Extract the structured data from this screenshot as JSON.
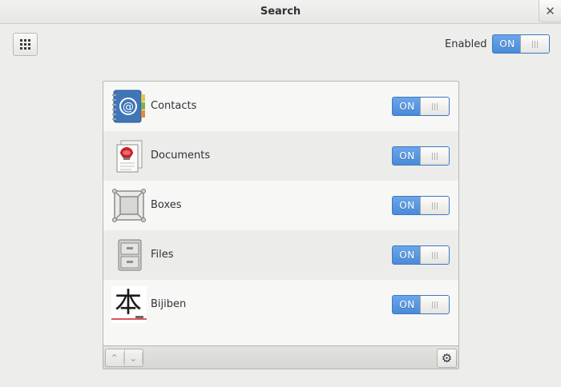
{
  "window": {
    "title": "Search",
    "close_symbol": "✕"
  },
  "header": {
    "enabled_label": "Enabled",
    "enabled_switch": "ON"
  },
  "sources": [
    {
      "name": "Contacts",
      "icon": "contacts-icon",
      "switch": "ON"
    },
    {
      "name": "Documents",
      "icon": "documents-icon",
      "switch": "ON"
    },
    {
      "name": "Boxes",
      "icon": "boxes-icon",
      "switch": "ON"
    },
    {
      "name": "Files",
      "icon": "files-icon",
      "switch": "ON"
    },
    {
      "name": "Bijiben",
      "icon": "bijiben-icon",
      "switch": "ON"
    }
  ],
  "toolbar": {
    "move_up": "⌃",
    "move_down": "⌄",
    "settings": "⚙"
  },
  "colors": {
    "accent": "#4a8ad8",
    "background": "#ededeb"
  }
}
